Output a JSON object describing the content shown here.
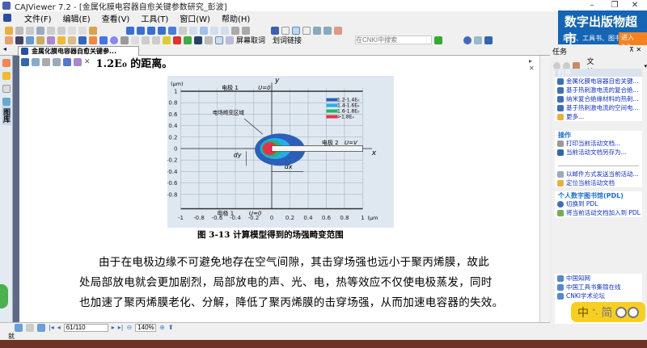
{
  "window": {
    "title": "CAJViewer 7.2 - [金属化膜电容器自愈关键参数研究_彭波]",
    "minimize": "–",
    "restore": "❐",
    "close": "✕"
  },
  "menu": [
    "文件(F)",
    "编辑(E)",
    "查看(V)",
    "工具(T)",
    "窗口(W)",
    "帮助(H)"
  ],
  "toolbar": {
    "screen_word": "屏幕取词",
    "word_link": "划词链接",
    "search_placeholder": "在CNKI中搜索"
  },
  "ad": {
    "title": "数字出版物超市",
    "subtitle": "期刊、工具书、图书……",
    "button": "进入>>"
  },
  "tab": {
    "label": "金属化膜电容器自愈关键参..."
  },
  "left_tab": "图库",
  "document": {
    "top_line": "1.2E₀ 的距离。",
    "caption": "图 3-13  计算模型得到的场强畸变范围",
    "paragraphs": [
      "由于在电极边缘不可避免地存在空气间隙，其击穿场强也远小于聚丙烯膜，故此",
      "处局部放电就会更加剧烈，局部放电的声、光、电，热等效应不仅使电极蒸发，同时",
      "也加速了聚丙烯膜老化、分解，降低了聚丙烯膜的击穿场强，从而加速电容器的失效。"
    ],
    "figure": {
      "x_ticks": [
        "-1",
        "-0.8",
        "-0.6",
        "-0.4",
        "-0.2",
        "0",
        "0.2",
        "0.4",
        "0.6",
        "0.8",
        "1"
      ],
      "y_ticks": [
        "1",
        "0.8",
        "0.6",
        "0.4",
        "0.2",
        "0",
        "-0.2",
        "-0.4",
        "-0.6",
        "-0.8"
      ],
      "y_unit": "(μm)",
      "x_unit": "(μm",
      "x_axis": "x",
      "y_axis": "y",
      "electrode1_top": "电极 1",
      "u0_top": "U=0",
      "electrode1_bottom": "电极 1",
      "u0_bottom": "U=0",
      "electrode2": "电极 2",
      "uv": "U=V",
      "region": "电场畸变区域",
      "dx": "dx",
      "dy": "dy",
      "legend": [
        {
          "label": "1.2-1.4E₀",
          "color": "#2b5fb8"
        },
        {
          "label": "1.4-1.6E₀",
          "color": "#22aee8"
        },
        {
          "label": "1.6-1.8E₀",
          "color": "#25b36a"
        },
        {
          "label": ">1.8E₀",
          "color": "#e8304a"
        }
      ]
    }
  },
  "nav": {
    "page": "61/110",
    "zoom": "140%"
  },
  "status": "就",
  "task_pane": {
    "title": "任务",
    "doc_label": "文档",
    "open_header": "打开",
    "open_items": [
      "金属化膜电容器自愈关键...",
      "基于热刺激电流的复合绝...",
      "纳米复合绝缘材料的热刺...",
      "基于热刺激电流的空间电...",
      "更多..."
    ],
    "ops_header": "操作",
    "ops_items": [
      "打印当前活动文档...",
      "当前活动文档另存为...",
      "以邮件方式发送当前活动...",
      "定位当前活动文档"
    ],
    "pdl_header": "个人数字图书馆(PDL)",
    "pdl_items": [
      "切换到 PDL",
      "将当前活动文档加入到 PDL"
    ],
    "links": [
      "中国知网",
      "中国工具书集锦在线",
      "CNKI学术论坛"
    ]
  },
  "ime": {
    "lang": "中",
    "punct": "°,",
    "mode": "简"
  }
}
